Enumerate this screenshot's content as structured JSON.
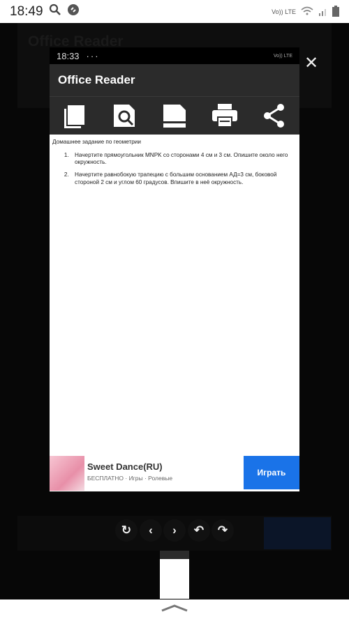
{
  "status_bar": {
    "time": "18:49",
    "network": "Vo)) LTE"
  },
  "screenshot": {
    "status_bar": {
      "time": "18:33",
      "dots": "···",
      "network": "Vo)) LTE"
    },
    "app_title": "Office Reader",
    "toolbar": [
      "copy-icon",
      "document-search-icon",
      "document-icon",
      "print-icon",
      "share-icon"
    ],
    "document": {
      "heading": "Домашнее задание по геометрии",
      "items": [
        "Начертите прямоугольник  MNPK со сторонами 4 см и 3 см. Опишите около него окружность.",
        "Начертите равнобокую трапецию с большим основанием АД=3 см, боковой стороной 2 см и углом 60 градусов. Впишите  в неё окружность."
      ]
    },
    "ad": {
      "title": "Sweet Dance(RU)",
      "subtitle": "БЕСПЛАТНО · Игры · Ролевые",
      "button": "Играть"
    }
  },
  "controls": {
    "close": "✕",
    "refresh": "↻",
    "prev": "‹",
    "next": "›",
    "undo": "↶",
    "redo": "↷"
  },
  "accent": "#1a73e8"
}
